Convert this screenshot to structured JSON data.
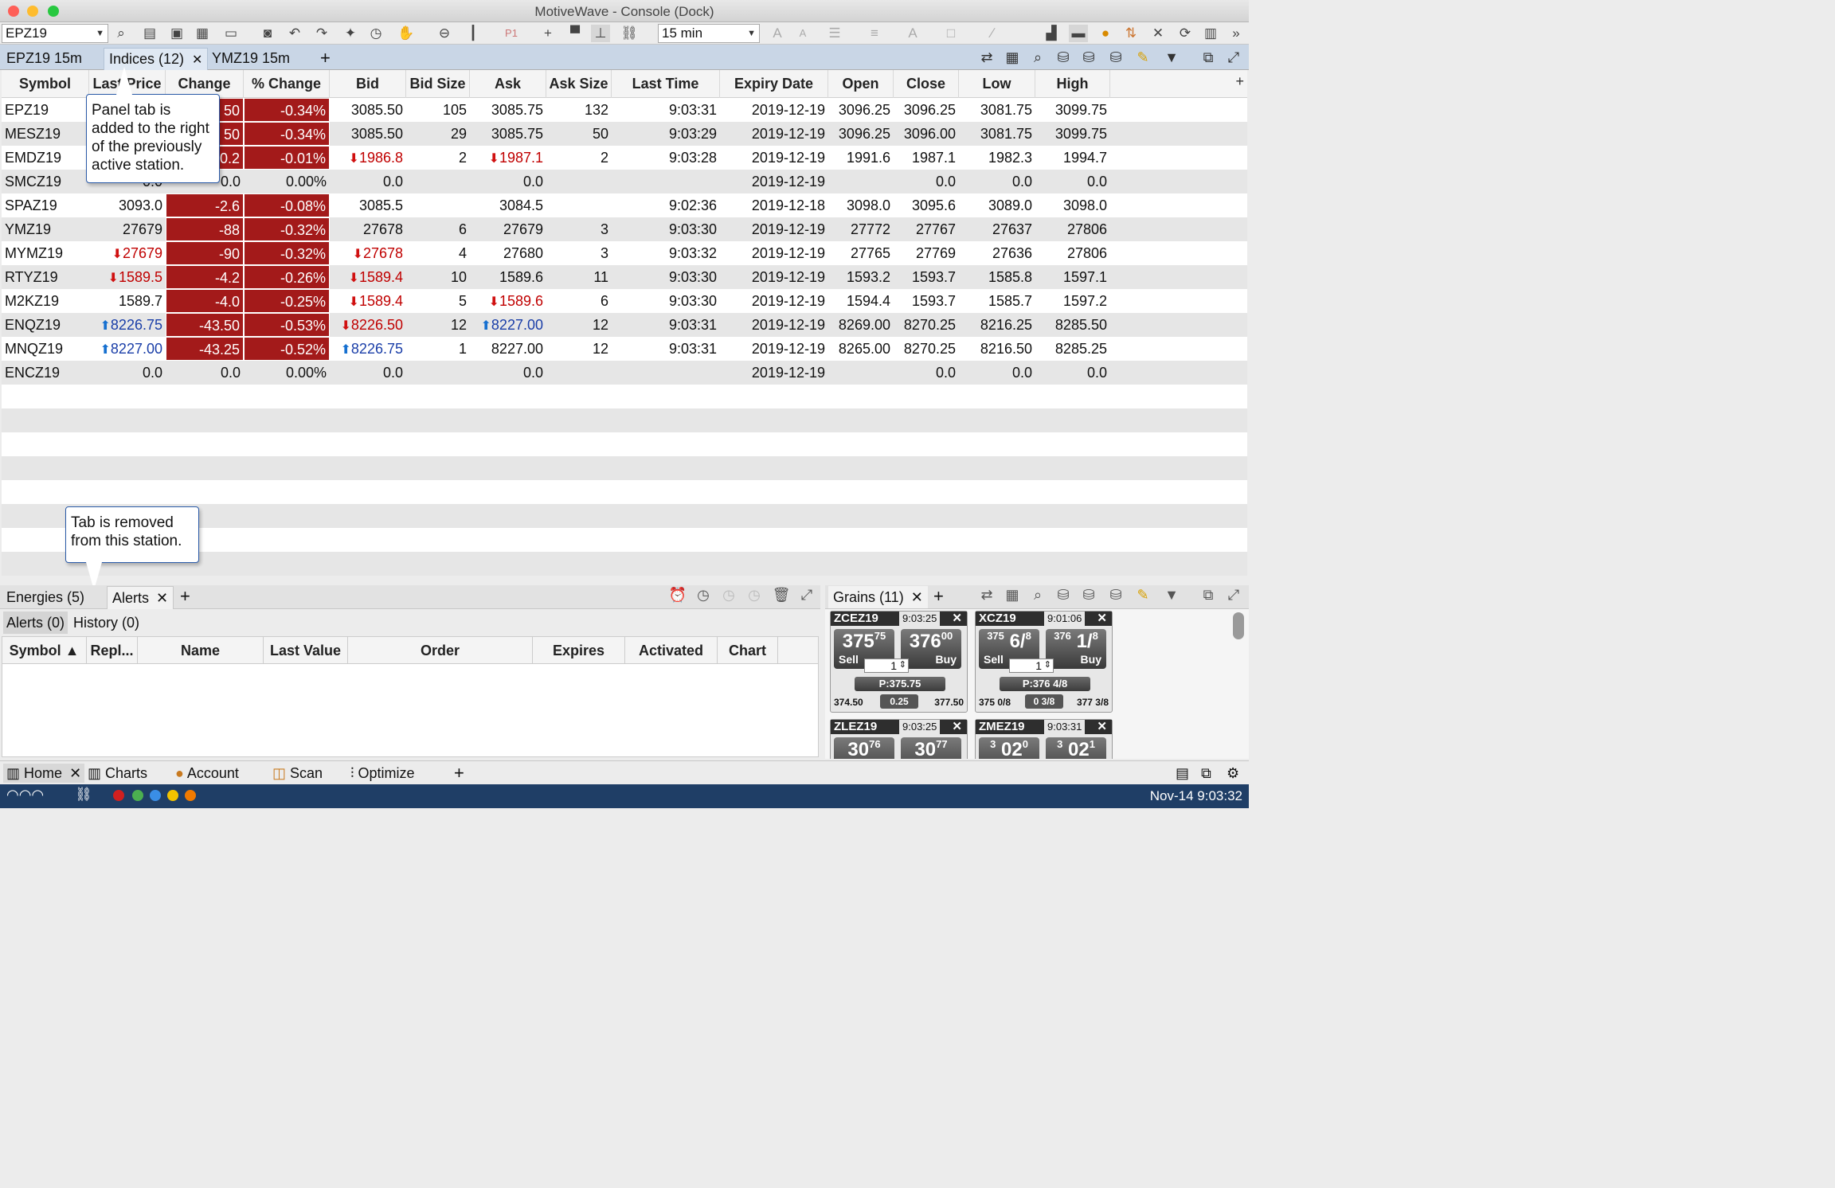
{
  "window": {
    "title": "MotiveWave - Console (Dock)"
  },
  "toolbar": {
    "symbol": "EPZ19",
    "interval": "15 min"
  },
  "top_tabs": [
    {
      "label": "EPZ19 15m"
    },
    {
      "label": "Indices (12)"
    },
    {
      "label": "YMZ19 15m"
    }
  ],
  "grid": {
    "columns": [
      "Symbol",
      "Last Price",
      "Change",
      "% Change",
      "Bid",
      "Bid Size",
      "Ask",
      "Ask Size",
      "Last Time",
      "Expiry Date",
      "Open",
      "Close",
      "Low",
      "High"
    ],
    "rows": [
      {
        "symbol": "EPZ19",
        "last": "",
        "last_dir": "",
        "change": "",
        "change_neg": true,
        "pct": "-0.34%",
        "pct_neg": true,
        "bid": "3085.50",
        "bid_dir": "",
        "bid_size": "105",
        "ask": "3085.75",
        "ask_dir": "",
        "ask_size": "132",
        "time": "9:03:31",
        "expiry": "2019-12-19",
        "open": "3096.25",
        "close": "3096.25",
        "low": "3081.75",
        "high": "3099.75"
      },
      {
        "symbol": "MESZ19",
        "last": "",
        "last_dir": "",
        "change": "",
        "change_neg": true,
        "pct": "-0.34%",
        "pct_neg": true,
        "bid": "3085.50",
        "bid_dir": "",
        "bid_size": "29",
        "ask": "3085.75",
        "ask_dir": "",
        "ask_size": "50",
        "time": "9:03:29",
        "expiry": "2019-12-19",
        "open": "3096.25",
        "close": "3096.00",
        "low": "3081.75",
        "high": "3099.75"
      },
      {
        "symbol": "EMDZ19",
        "last": "",
        "last_dir": "",
        "change": "",
        "change_neg": true,
        "pct": "-0.01%",
        "pct_neg": true,
        "bid": "1986.8",
        "bid_dir": "down",
        "bid_size": "2",
        "ask": "1987.1",
        "ask_dir": "down",
        "ask_size": "2",
        "time": "9:03:28",
        "expiry": "2019-12-19",
        "open": "1991.6",
        "close": "1987.1",
        "low": "1982.3",
        "high": "1994.7"
      },
      {
        "symbol": "SMCZ19",
        "last": "",
        "last_dir": "",
        "change": "0.0",
        "change_neg": false,
        "pct": "0.00%",
        "pct_neg": false,
        "bid": "0.0",
        "bid_dir": "",
        "bid_size": "",
        "ask": "0.0",
        "ask_dir": "",
        "ask_size": "",
        "time": "",
        "expiry": "2019-12-19",
        "open": "",
        "close": "0.0",
        "low": "0.0",
        "high": "0.0"
      },
      {
        "symbol": "SPAZ19",
        "last": "3093.0",
        "last_dir": "",
        "change": "-2.6",
        "change_neg": true,
        "pct": "-0.08%",
        "pct_neg": true,
        "bid": "3085.5",
        "bid_dir": "",
        "bid_size": "",
        "ask": "3084.5",
        "ask_dir": "",
        "ask_size": "",
        "time": "9:02:36",
        "expiry": "2019-12-18",
        "open": "3098.0",
        "close": "3095.6",
        "low": "3089.0",
        "high": "3098.0"
      },
      {
        "symbol": "YMZ19",
        "last": "27679",
        "last_dir": "",
        "change": "-88",
        "change_neg": true,
        "pct": "-0.32%",
        "pct_neg": true,
        "bid": "27678",
        "bid_dir": "",
        "bid_size": "6",
        "ask": "27679",
        "ask_dir": "",
        "ask_size": "3",
        "time": "9:03:30",
        "expiry": "2019-12-19",
        "open": "27772",
        "close": "27767",
        "low": "27637",
        "high": "27806"
      },
      {
        "symbol": "MYMZ19",
        "last": "27679",
        "last_dir": "down",
        "change": "-90",
        "change_neg": true,
        "pct": "-0.32%",
        "pct_neg": true,
        "bid": "27678",
        "bid_dir": "down",
        "bid_size": "4",
        "ask": "27680",
        "ask_dir": "",
        "ask_size": "3",
        "time": "9:03:32",
        "expiry": "2019-12-19",
        "open": "27765",
        "close": "27769",
        "low": "27636",
        "high": "27806"
      },
      {
        "symbol": "RTYZ19",
        "last": "1589.5",
        "last_dir": "down",
        "change": "-4.2",
        "change_neg": true,
        "pct": "-0.26%",
        "pct_neg": true,
        "bid": "1589.4",
        "bid_dir": "down",
        "bid_size": "10",
        "ask": "1589.6",
        "ask_dir": "",
        "ask_size": "11",
        "time": "9:03:30",
        "expiry": "2019-12-19",
        "open": "1593.2",
        "close": "1593.7",
        "low": "1585.8",
        "high": "1597.1"
      },
      {
        "symbol": "M2KZ19",
        "last": "1589.7",
        "last_dir": "",
        "change": "-4.0",
        "change_neg": true,
        "pct": "-0.25%",
        "pct_neg": true,
        "bid": "1589.4",
        "bid_dir": "down",
        "bid_size": "5",
        "ask": "1589.6",
        "ask_dir": "down",
        "ask_size": "6",
        "time": "9:03:30",
        "expiry": "2019-12-19",
        "open": "1594.4",
        "close": "1593.7",
        "low": "1585.7",
        "high": "1597.2"
      },
      {
        "symbol": "ENQZ19",
        "last": "8226.75",
        "last_dir": "up",
        "change": "-43.50",
        "change_neg": true,
        "pct": "-0.53%",
        "pct_neg": true,
        "bid": "8226.50",
        "bid_dir": "down",
        "bid_size": "12",
        "ask": "8227.00",
        "ask_dir": "up",
        "ask_size": "12",
        "time": "9:03:31",
        "expiry": "2019-12-19",
        "open": "8269.00",
        "close": "8270.25",
        "low": "8216.25",
        "high": "8285.50"
      },
      {
        "symbol": "MNQZ19",
        "last": "8227.00",
        "last_dir": "up",
        "change": "-43.25",
        "change_neg": true,
        "pct": "-0.52%",
        "pct_neg": true,
        "bid": "8226.75",
        "bid_dir": "up",
        "bid_size": "1",
        "ask": "8227.00",
        "ask_dir": "",
        "ask_size": "12",
        "time": "9:03:31",
        "expiry": "2019-12-19",
        "open": "8265.00",
        "close": "8270.25",
        "low": "8216.50",
        "high": "8285.25"
      },
      {
        "symbol": "ENCZ19",
        "last": "0.0",
        "last_dir": "",
        "change": "0.0",
        "change_neg": false,
        "pct": "0.00%",
        "pct_neg": false,
        "bid": "0.0",
        "bid_dir": "",
        "bid_size": "",
        "ask": "0.0",
        "ask_dir": "",
        "ask_size": "",
        "time": "",
        "expiry": "2019-12-19",
        "open": "",
        "close": "0.0",
        "low": "0.0",
        "high": "0.0"
      }
    ],
    "partial": {
      "r0_change": "50",
      "r1_change": "50",
      "r2_change": "0.2",
      "r3_last": "0.0"
    }
  },
  "callouts": {
    "panel_tab": "Panel tab is added to the right of the previously active station.",
    "tab_removed": "Tab is removed from this station."
  },
  "lower_tabs": [
    {
      "label": "Energies (5)"
    },
    {
      "label": "Alerts"
    }
  ],
  "alerts": {
    "subtabs": [
      "Alerts (0)",
      "History (0)"
    ],
    "columns": [
      "Symbol ▲",
      "Repl...",
      "Name",
      "Last Value",
      "Order",
      "Expires",
      "Activated",
      "Chart"
    ]
  },
  "grains": {
    "tab": "Grains (11)",
    "cards": [
      {
        "symbol": "ZCEZ19",
        "time": "9:03:25",
        "sell_main": "375",
        "sell_frac": "75",
        "buy_main": "376",
        "buy_frac": "00",
        "qty": "1",
        "position": "P:375.75",
        "low": "374.50",
        "spread": "0.25",
        "high": "377.50"
      },
      {
        "symbol": "XCZ19",
        "time": "9:01:06",
        "sell_main": "6/",
        "sell_frac": "8",
        "buy_main": "1/",
        "buy_frac": "8",
        "sell_pre": "375",
        "buy_pre": "376",
        "qty": "1",
        "position": "P:376 4/8",
        "low": "375 0/8",
        "spread": "0 3/8",
        "high": "377 3/8"
      },
      {
        "symbol": "ZLEZ19",
        "time": "9:03:25",
        "sell_main": "30",
        "sell_frac": "76",
        "buy_main": "30",
        "buy_frac": "77"
      },
      {
        "symbol": "ZMEZ19",
        "time": "9:03:31",
        "sell_main": "02",
        "sell_frac": "0",
        "buy_main": "02",
        "buy_frac": "1",
        "sell_pre": "3",
        "buy_pre": "3"
      }
    ],
    "sell_label": "Sell",
    "buy_label": "Buy"
  },
  "bottom_nav": [
    {
      "label": "Home"
    },
    {
      "label": "Charts"
    },
    {
      "label": "Account"
    },
    {
      "label": "Scan"
    },
    {
      "label": "Optimize"
    }
  ],
  "status": {
    "datetime": "Nov-14 9:03:32"
  },
  "colors": {
    "neg_cell": "#a31a1a",
    "tab_bar": "#c9d6e6",
    "status_bar": "#1f3e66"
  }
}
